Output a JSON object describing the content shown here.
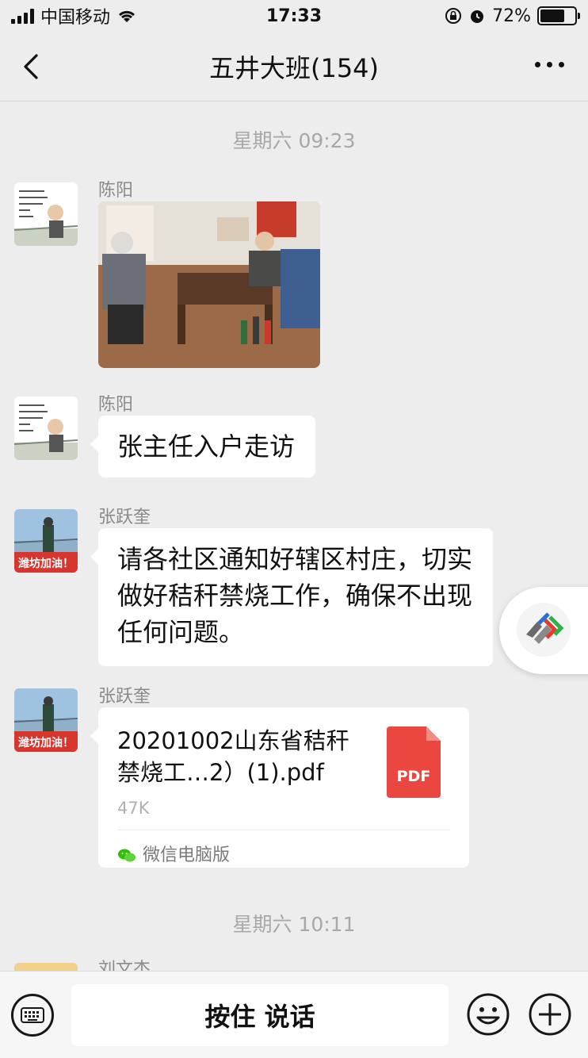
{
  "status": {
    "carrier": "中国移动",
    "time": "17:33",
    "battery": "72%",
    "battery_level": 0.72
  },
  "nav": {
    "title": "五井大班(154)"
  },
  "timestamps": [
    "星期六 09:23",
    "星期六 10:11"
  ],
  "messages": [
    {
      "sender": "陈阳",
      "type": "image"
    },
    {
      "sender": "陈阳",
      "text": "张主任入户走访"
    },
    {
      "sender": "张跃奎",
      "text": "请各社区通知好辖区村庄，切实做好秸秆禁烧工作，确保不出现任何问题。"
    },
    {
      "sender": "张跃奎",
      "type": "file",
      "file_name": "20201002山东省秸秆禁烧工…2）(1).pdf",
      "file_size": "47K",
      "file_badge": "PDF",
      "source": "微信电脑版"
    }
  ],
  "avatar_caption": "潍坊加油！",
  "partial_sender": "刘文杰",
  "input": {
    "talk_label": "按住 说话"
  }
}
